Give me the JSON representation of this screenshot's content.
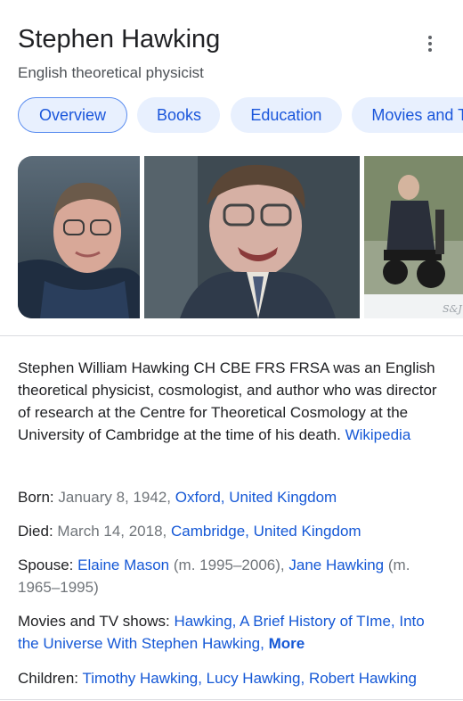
{
  "header": {
    "title": "Stephen Hawking",
    "subtitle": "English theoretical physicist"
  },
  "tabs": [
    {
      "label": "Overview"
    },
    {
      "label": "Books"
    },
    {
      "label": "Education"
    },
    {
      "label": "Movies and TV"
    }
  ],
  "images": {
    "signature_text": "S&J"
  },
  "description": {
    "text": "Stephen William Hawking CH CBE FRS FRSA was an English theoretical physicist, cosmologist, and author who was director of research at the Centre for Theoretical Cosmology at the University of Cambridge at the time of his death.",
    "source": "Wikipedia"
  },
  "facts": {
    "born": {
      "label": "Born:",
      "date": "January 8, 1942,",
      "place1": "Oxford",
      "sep": ", ",
      "place2": "United Kingdom"
    },
    "died": {
      "label": "Died:",
      "date": "March 14, 2018,",
      "place1": "Cambridge",
      "sep": ", ",
      "place2": "United Kingdom"
    },
    "spouse": {
      "label": "Spouse:",
      "name1": "Elaine Mason",
      "years1": "(m. 1995–2006),",
      "name2": "Jane Hawking",
      "years2": "(m. 1965–1995)"
    },
    "movies": {
      "label": "Movies and TV shows:",
      "item1": "Hawking",
      "item2": "A Brief History of TIme",
      "item3": "Into the Universe With Stephen Hawking",
      "more": "More",
      "sep": ", "
    },
    "children": {
      "label": "Children:",
      "item1": "Timothy Hawking",
      "item2": "Lucy Hawking",
      "item3": "Robert Hawking",
      "sep": ", "
    }
  }
}
